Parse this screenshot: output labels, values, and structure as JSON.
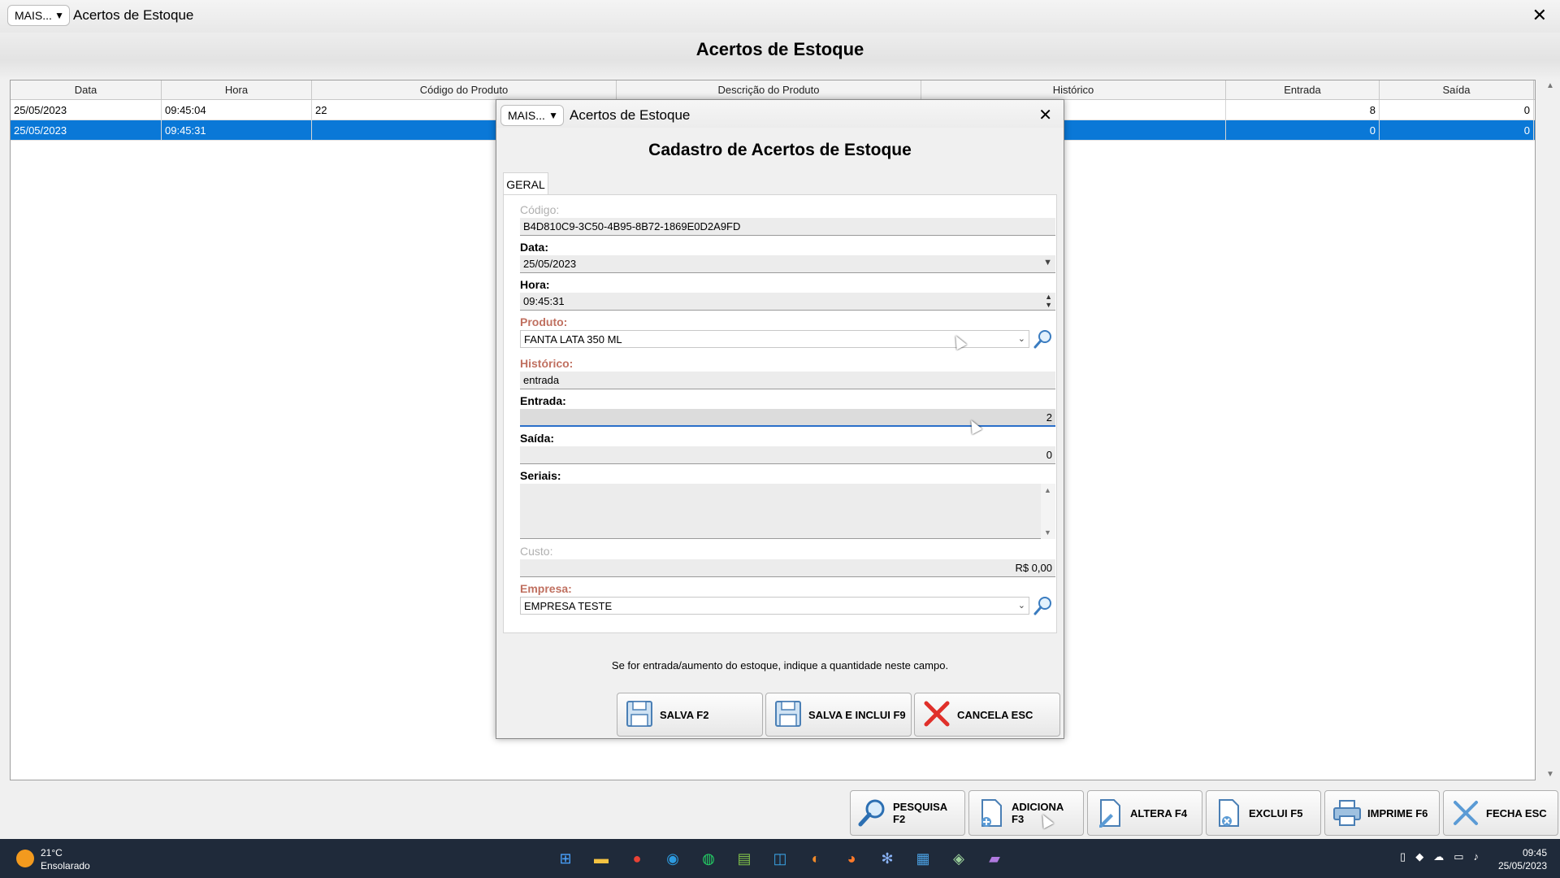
{
  "window": {
    "mais_label": "MAIS...",
    "title": "Acertos de Estoque",
    "close": "✕",
    "heading": "Acertos de Estoque"
  },
  "grid": {
    "columns": [
      "Data",
      "Hora",
      "Código do Produto",
      "Descrição do Produto",
      "Histórico",
      "Entrada",
      "Saída"
    ],
    "rows": [
      {
        "data": "25/05/2023",
        "hora": "09:45:04",
        "codigo": "22",
        "descricao": "",
        "historico": "",
        "entrada": "8",
        "saida": "0"
      },
      {
        "data": "25/05/2023",
        "hora": "09:45:31",
        "codigo": "",
        "descricao": "",
        "historico": "",
        "entrada": "0",
        "saida": "0"
      }
    ]
  },
  "toolbar": {
    "pesquisa": "PESQUISA F2",
    "adiciona": "ADICIONA F3",
    "altera": "ALTERA F4",
    "exclui": "EXCLUI F5",
    "imprime": "IMPRIME F6",
    "fecha": "FECHA ESC"
  },
  "modal": {
    "mais_label": "MAIS...",
    "title": "Acertos de Estoque",
    "close": "✕",
    "heading": "Cadastro de Acertos de Estoque",
    "tab": "GERAL",
    "fields": {
      "codigo_label": "Código:",
      "codigo_value": "B4D810C9-3C50-4B95-8B72-1869E0D2A9FD",
      "data_label": "Data:",
      "data_value": "25/05/2023",
      "hora_label": "Hora:",
      "hora_value": "09:45:31",
      "produto_label": "Produto:",
      "produto_value": "FANTA LATA 350 ML",
      "historico_label": "Histórico:",
      "historico_value": "entrada",
      "entrada_label": "Entrada:",
      "entrada_value": "2",
      "saida_label": "Saída:",
      "saida_value": "0",
      "seriais_label": "Seriais:",
      "custo_label": "Custo:",
      "custo_value": "R$ 0,00",
      "empresa_label": "Empresa:",
      "empresa_value": "EMPRESA TESTE"
    },
    "hint": "Se for entrada/aumento do estoque, indique a quantidade neste campo.",
    "buttons": {
      "salva": "SALVA F2",
      "salva_inclui": "SALVA E INCLUI F9",
      "cancela": "CANCELA ESC"
    }
  },
  "taskbar": {
    "temperature": "21°C",
    "condition": "Ensolarado",
    "time": "09:45",
    "date": "25/05/2023"
  },
  "colors": {
    "selection": "#0a78d7",
    "required_label": "#c07060",
    "taskbar": "#1f2a3a"
  }
}
